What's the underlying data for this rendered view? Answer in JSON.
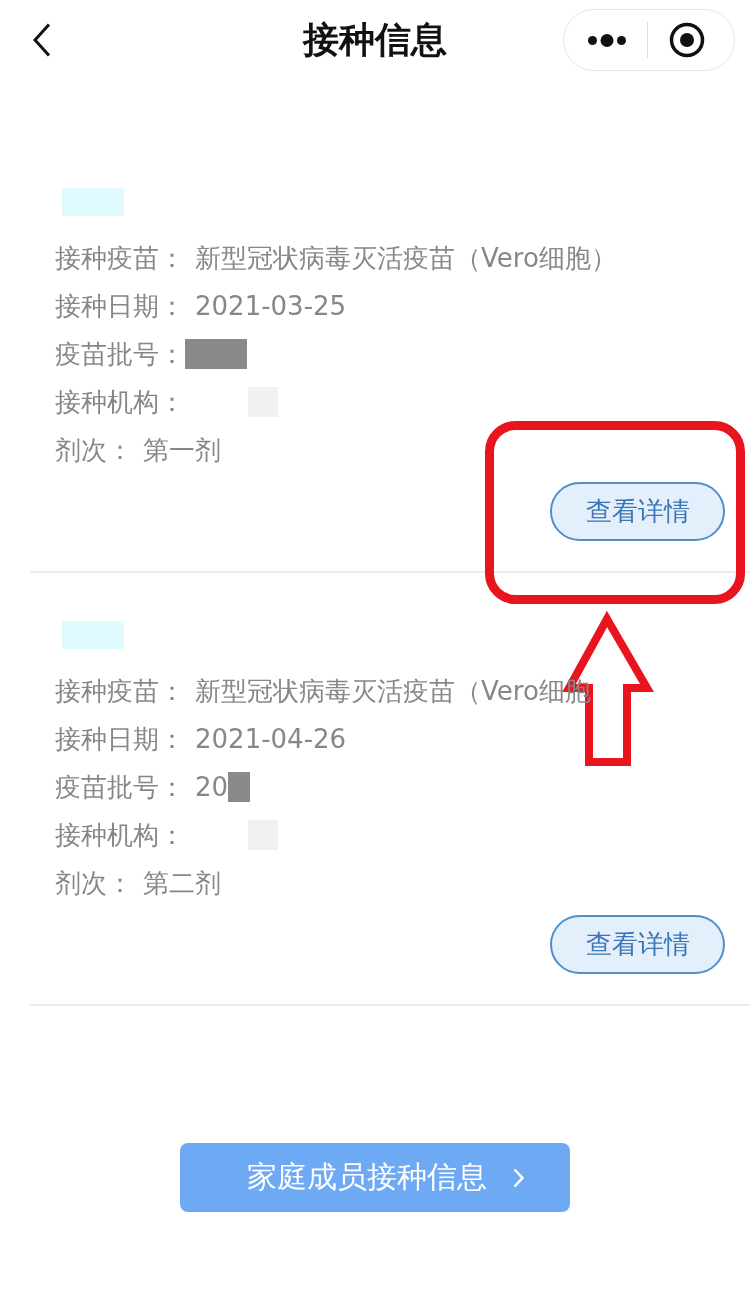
{
  "nav_bar": {
    "title": "接种信息"
  },
  "records": [
    {
      "name_redacted": true,
      "highlighted": true,
      "fields": [
        {
          "kind": "text",
          "label": "接种疫苗：",
          "value": "新型冠状病毒灭活疫苗（Vero细胞）"
        },
        {
          "kind": "text",
          "label": "接种日期：",
          "value": "2021-03-25"
        },
        {
          "kind": "blurred",
          "label": "疫苗批号："
        },
        {
          "kind": "faded",
          "label": "接种机构："
        },
        {
          "kind": "text",
          "label": "剂次：",
          "value": "第一剂"
        }
      ],
      "detail_button": "查看详情"
    },
    {
      "name_redacted": true,
      "highlighted": false,
      "fields": [
        {
          "kind": "text",
          "label": "接种疫苗：",
          "value": "新型冠状病毒灭活疫苗（Vero细胞"
        },
        {
          "kind": "text",
          "label": "接种日期：",
          "value": "2021-04-26"
        },
        {
          "kind": "blurred",
          "label": "疫苗批号：",
          "value": "20"
        },
        {
          "kind": "faded",
          "label": "接种机构："
        },
        {
          "kind": "text",
          "label": "剂次：",
          "value": "第二剂"
        }
      ],
      "detail_button": "查看详情"
    }
  ],
  "family_button": {
    "label": "家庭成员接种信息"
  }
}
